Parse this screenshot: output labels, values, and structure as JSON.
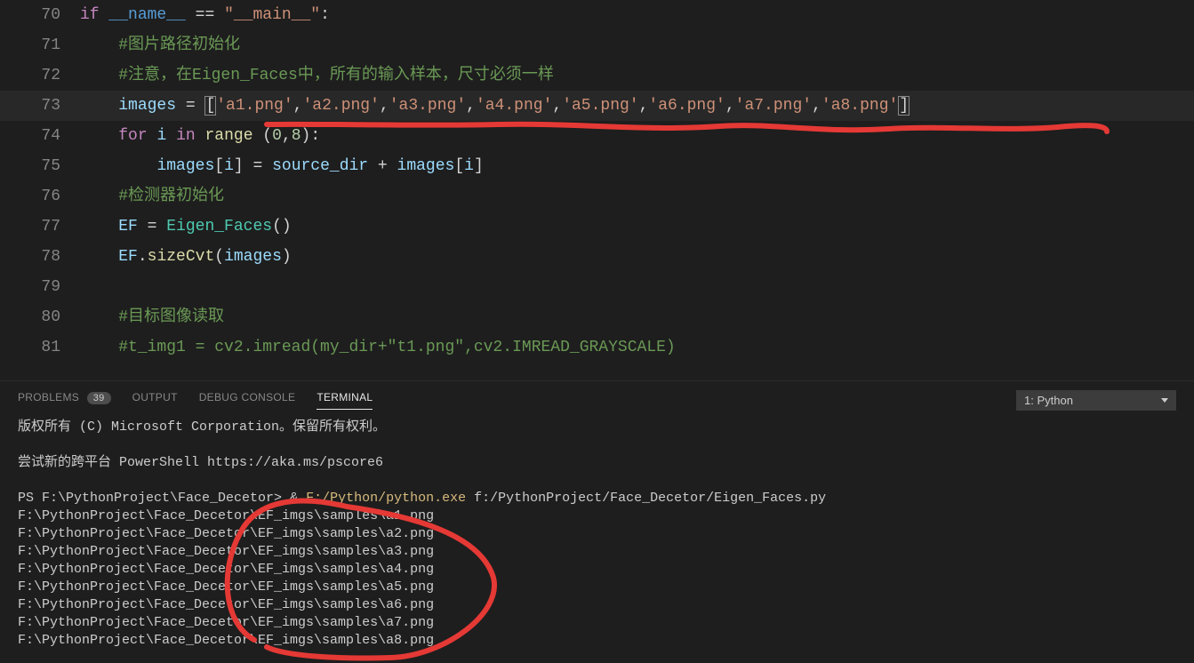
{
  "editor": {
    "lines": [
      {
        "num": 70,
        "seg": [
          [
            "kw",
            "if"
          ],
          [
            "op",
            " "
          ],
          [
            "builtin",
            "__name__"
          ],
          [
            "op",
            " == "
          ],
          [
            "str",
            "\"__main__\""
          ],
          [
            "op",
            ":"
          ]
        ],
        "indent": 0,
        "guide": false
      },
      {
        "num": 71,
        "seg": [
          [
            "comment",
            "#图片路径初始化"
          ]
        ],
        "indent": 2,
        "guide": true
      },
      {
        "num": 72,
        "seg": [
          [
            "comment",
            "#注意，在Eigen_Faces中，所有的输入样本，尺寸必须一样"
          ]
        ],
        "indent": 2,
        "guide": true
      },
      {
        "num": 73,
        "seg": [
          [
            "var",
            "images"
          ],
          [
            "op",
            " = "
          ],
          [
            "brhl",
            "["
          ],
          [
            "str",
            "'a1.png'"
          ],
          [
            "op",
            ","
          ],
          [
            "str",
            "'a2.png'"
          ],
          [
            "op",
            ","
          ],
          [
            "str",
            "'a3.png'"
          ],
          [
            "op",
            ","
          ],
          [
            "str",
            "'a4.png'"
          ],
          [
            "op",
            ","
          ],
          [
            "str",
            "'a5.png'"
          ],
          [
            "op",
            ","
          ],
          [
            "str",
            "'a6.png'"
          ],
          [
            "op",
            ","
          ],
          [
            "str",
            "'a7.png'"
          ],
          [
            "op",
            ","
          ],
          [
            "str",
            "'a8.png'"
          ],
          [
            "brhl",
            "]"
          ]
        ],
        "indent": 2,
        "guide": true,
        "highlight": true
      },
      {
        "num": 74,
        "seg": [
          [
            "kw",
            "for"
          ],
          [
            "op",
            " "
          ],
          [
            "var",
            "i"
          ],
          [
            "op",
            " "
          ],
          [
            "kw",
            "in"
          ],
          [
            "op",
            " "
          ],
          [
            "fn",
            "range"
          ],
          [
            "op",
            " ("
          ],
          [
            "num",
            "0"
          ],
          [
            "op",
            ","
          ],
          [
            "num",
            "8"
          ],
          [
            "op",
            "):"
          ]
        ],
        "indent": 2,
        "guide": true
      },
      {
        "num": 75,
        "seg": [
          [
            "var",
            "images"
          ],
          [
            "op",
            "["
          ],
          [
            "var",
            "i"
          ],
          [
            "op",
            "] = "
          ],
          [
            "var",
            "source_dir"
          ],
          [
            "op",
            " + "
          ],
          [
            "var",
            "images"
          ],
          [
            "op",
            "["
          ],
          [
            "var",
            "i"
          ],
          [
            "op",
            "]"
          ]
        ],
        "indent": 4,
        "guide2": true
      },
      {
        "num": 76,
        "seg": [
          [
            "comment",
            "#检测器初始化"
          ]
        ],
        "indent": 2,
        "guide": true
      },
      {
        "num": 77,
        "seg": [
          [
            "var",
            "EF"
          ],
          [
            "op",
            " = "
          ],
          [
            "cls",
            "Eigen_Faces"
          ],
          [
            "op",
            "()"
          ]
        ],
        "indent": 2,
        "guide": true
      },
      {
        "num": 78,
        "seg": [
          [
            "var",
            "EF"
          ],
          [
            "op",
            "."
          ],
          [
            "fn",
            "sizeCvt"
          ],
          [
            "op",
            "("
          ],
          [
            "var",
            "images"
          ],
          [
            "op",
            ")"
          ]
        ],
        "indent": 2,
        "guide": true
      },
      {
        "num": 79,
        "seg": [],
        "indent": 0,
        "guide": false
      },
      {
        "num": 80,
        "seg": [
          [
            "comment",
            "#目标图像读取"
          ]
        ],
        "indent": 2,
        "guide": true
      },
      {
        "num": 81,
        "seg": [
          [
            "comment",
            "#t_img1 = cv2.imread(my_dir+\"t1.png\",cv2.IMREAD_GRAYSCALE)"
          ]
        ],
        "indent": 2,
        "guide": true
      }
    ]
  },
  "panel": {
    "tabs": {
      "problems": "Problems",
      "problems_badge": "39",
      "output": "Output",
      "debug": "Debug Console",
      "terminal": "Terminal"
    },
    "dropdown": "1: Python"
  },
  "terminal": {
    "line1": "版权所有 (C) Microsoft Corporation。保留所有权利。",
    "line2": "",
    "line3": "尝试新的跨平台 PowerShell https://aka.ms/pscore6",
    "line4": "",
    "ps_prefix": "PS F:\\PythonProject\\Face_Decetor> ",
    "ps_cmd_amp": "& ",
    "ps_cmd_exe": "F:/Python/python.exe",
    "ps_cmd_arg": " f:/PythonProject/Face_Decetor/Eigen_Faces.py",
    "out": [
      "F:\\PythonProject\\Face_Decetor\\EF_imgs\\samples\\a1.png",
      "F:\\PythonProject\\Face_Decetor\\EF_imgs\\samples\\a2.png",
      "F:\\PythonProject\\Face_Decetor\\EF_imgs\\samples\\a3.png",
      "F:\\PythonProject\\Face_Decetor\\EF_imgs\\samples\\a4.png",
      "F:\\PythonProject\\Face_Decetor\\EF_imgs\\samples\\a5.png",
      "F:\\PythonProject\\Face_Decetor\\EF_imgs\\samples\\a6.png",
      "F:\\PythonProject\\Face_Decetor\\EF_imgs\\samples\\a7.png",
      "F:\\PythonProject\\Face_Decetor\\EF_imgs\\samples\\a8.png"
    ]
  }
}
